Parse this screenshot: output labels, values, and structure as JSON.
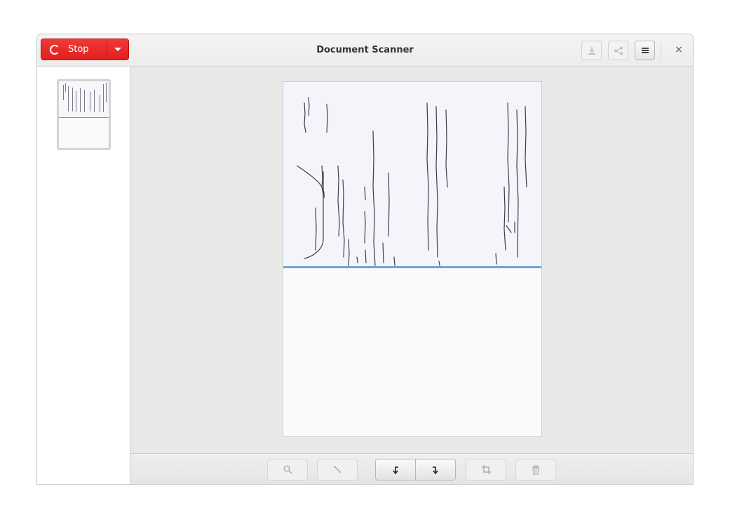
{
  "window": {
    "title": "Document Scanner"
  },
  "headerbar": {
    "stop_button": {
      "label": "Stop",
      "icon": "spinner-icon",
      "accent": "#e0201e"
    },
    "stop_menu_icon": "chevron-down-icon",
    "save_icon": "download-icon",
    "share_icon": "share-icon",
    "menu_icon": "hamburger-menu-icon",
    "close_glyph": "×"
  },
  "sidebar": {
    "pages": [
      {
        "name": "page-1-thumbnail"
      }
    ]
  },
  "preview": {
    "scan_progress": 0.52
  },
  "toolbar": {
    "buttons": [
      {
        "name": "zoom-icon",
        "enabled": false
      },
      {
        "name": "magic-wand-icon",
        "enabled": false
      },
      {
        "name": "rotate-left-icon",
        "enabled": true
      },
      {
        "name": "rotate-right-icon",
        "enabled": true
      },
      {
        "name": "crop-icon",
        "enabled": false
      },
      {
        "name": "trash-icon",
        "enabled": false
      }
    ]
  }
}
